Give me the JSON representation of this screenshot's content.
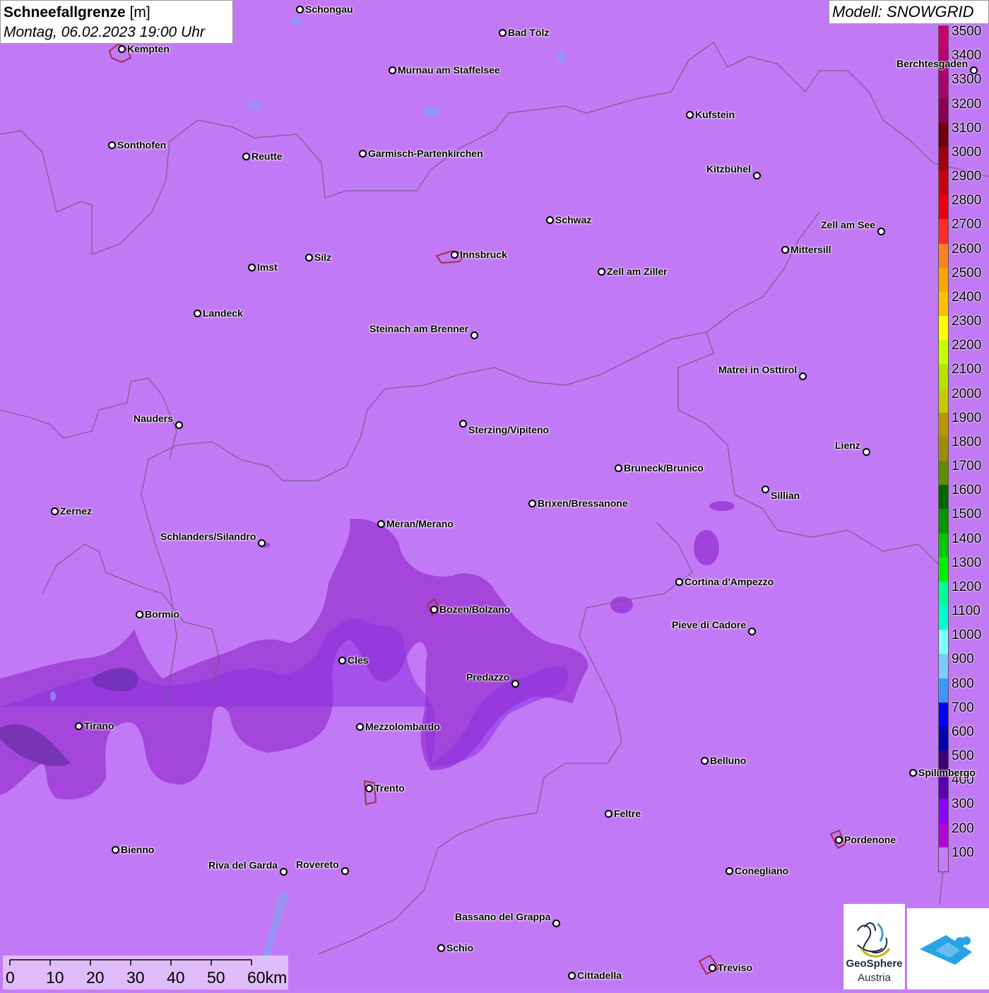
{
  "title": {
    "param": "Schneefallgrenze",
    "unit": "[m]",
    "datetime": "Montag, 06.02.2023 19:00 Uhr"
  },
  "model": "Modell: SNOWGRID",
  "legend": {
    "labels": [
      "3500",
      "3400",
      "3300",
      "3200",
      "3100",
      "3000",
      "2900",
      "2800",
      "2700",
      "2600",
      "2500",
      "2400",
      "2300",
      "2200",
      "2100",
      "2000",
      "1900",
      "1800",
      "1700",
      "1600",
      "1500",
      "1400",
      "1300",
      "1200",
      "1100",
      "1000",
      "900",
      "800",
      "700",
      "600",
      "500",
      "400",
      "300",
      "200",
      "100"
    ],
    "colors": [
      "#c8006e",
      "#b80070",
      "#a80070",
      "#8a0050",
      "#700010",
      "#a00010",
      "#c80010",
      "#e80010",
      "#ff2a2a",
      "#ff8020",
      "#ffa500",
      "#ffc000",
      "#ffff00",
      "#c8ff00",
      "#b8e000",
      "#c8c800",
      "#b89600",
      "#a08c00",
      "#608c00",
      "#006400",
      "#009600",
      "#00c800",
      "#00f000",
      "#00ff96",
      "#00ffd2",
      "#80ffff",
      "#80c8ff",
      "#3c96ff",
      "#0000ff",
      "#0000b4",
      "#3c0078",
      "#5a00b4",
      "#8c00ff",
      "#b400dc",
      "#c57cf6"
    ]
  },
  "cities": [
    {
      "name": "Schongau"
    },
    {
      "name": "Bad Tölz"
    },
    {
      "name": "Kempten"
    },
    {
      "name": "Murnau am Staffelsee"
    },
    {
      "name": "Berchtesgaden"
    },
    {
      "name": "Kufstein"
    },
    {
      "name": "Sonthofen"
    },
    {
      "name": "Reutte"
    },
    {
      "name": "Garmisch-Partenkirchen"
    },
    {
      "name": "Kitzbühel"
    },
    {
      "name": "Schwaz"
    },
    {
      "name": "Zell am See"
    },
    {
      "name": "Innsbruck"
    },
    {
      "name": "Mittersill"
    },
    {
      "name": "Imst"
    },
    {
      "name": "Silz"
    },
    {
      "name": "Zell am Ziller"
    },
    {
      "name": "Landeck"
    },
    {
      "name": "Steinach am Brenner"
    },
    {
      "name": "Matrei in Osttirol"
    },
    {
      "name": "Nauders"
    },
    {
      "name": "Sterzing/Vipiteno"
    },
    {
      "name": "Lienz"
    },
    {
      "name": "Bruneck/Brunico"
    },
    {
      "name": "Sillian"
    },
    {
      "name": "Zernez"
    },
    {
      "name": "Brixen/Bressanone"
    },
    {
      "name": "Meran/Merano"
    },
    {
      "name": "Schlanders/Silandro"
    },
    {
      "name": "Cortina d'Ampezzo"
    },
    {
      "name": "Bormio"
    },
    {
      "name": "Bozen/Bolzano"
    },
    {
      "name": "Pieve di Cadore"
    },
    {
      "name": "Cles"
    },
    {
      "name": "Predazzo"
    },
    {
      "name": "Tirano"
    },
    {
      "name": "Mezzolombardo"
    },
    {
      "name": "Belluno"
    },
    {
      "name": "Spilimbergo"
    },
    {
      "name": "Trento"
    },
    {
      "name": "Feltre"
    },
    {
      "name": "Pordenone"
    },
    {
      "name": "Bienno"
    },
    {
      "name": "Riva del Garda"
    },
    {
      "name": "Rovereto"
    },
    {
      "name": "Conegliano"
    },
    {
      "name": "Bassano del Grappa"
    },
    {
      "name": "Schio"
    },
    {
      "name": "Treviso"
    },
    {
      "name": "Cittadella"
    }
  ],
  "scale": {
    "ticks": [
      "0",
      "10",
      "20",
      "30",
      "40",
      "50",
      "60km"
    ]
  },
  "logos": {
    "geosphere_line1": "GeoSphere",
    "geosphere_line2": "Austria"
  }
}
